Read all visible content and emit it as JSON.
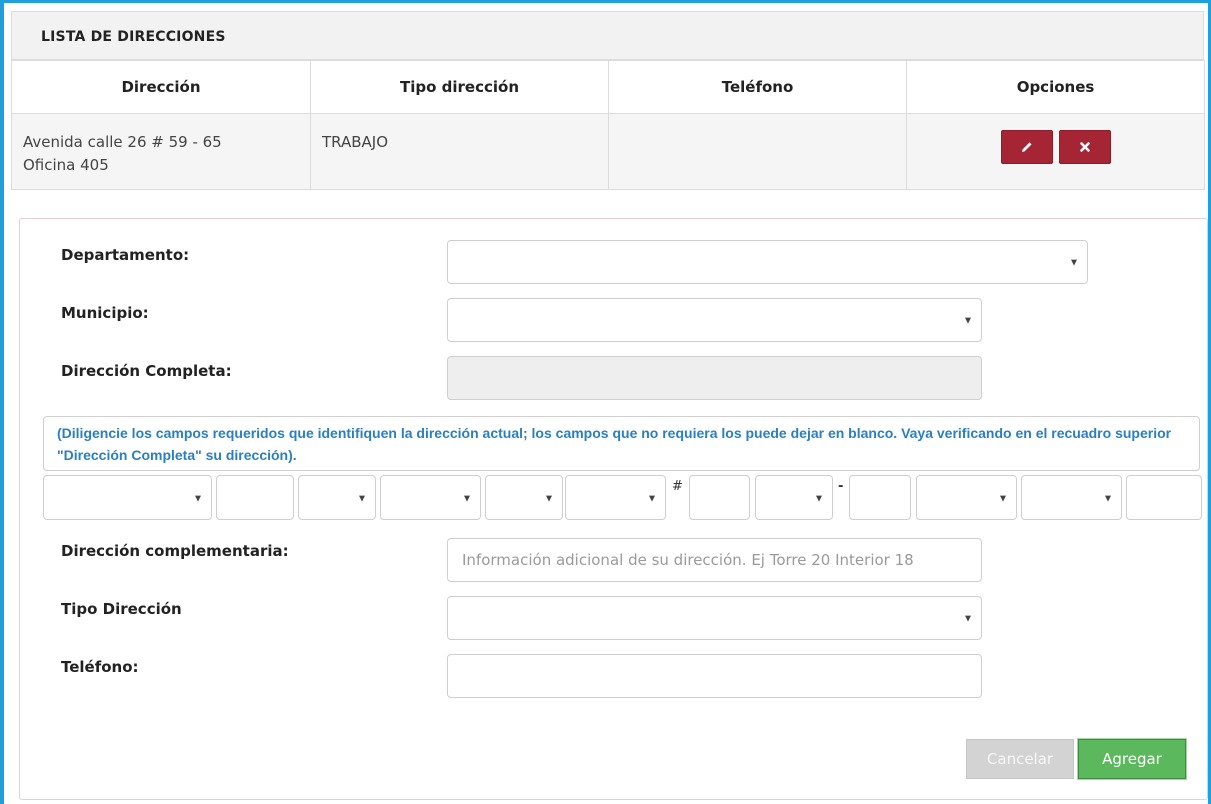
{
  "panel": {
    "title": "LISTA DE DIRECCIONES"
  },
  "table": {
    "columns": [
      "Dirección",
      "Tipo dirección",
      "Teléfono",
      "Opciones"
    ],
    "rows": [
      {
        "address_line1": "Avenida calle 26 # 59 - 65",
        "address_line2": "Oficina 405",
        "type": "TRABAJO",
        "phone": ""
      }
    ]
  },
  "form": {
    "departamento_label": "Departamento:",
    "municipio_label": "Municipio:",
    "direccion_completa_label": "Dirección Completa:",
    "hint": "(Diligencie los campos requeridos que identifiquen la dirección actual; los campos que no requiera los puede dejar en blanco. Vaya verificando en el recuadro superior \"Dirección Completa\" su dirección).",
    "hash_symbol": "#",
    "dash_symbol": "-",
    "complementaria_label": "Dirección complementaria:",
    "complementaria_placeholder": "Información adicional de su dirección. Ej Torre 20 Interior 18",
    "tipo_label": "Tipo Dirección",
    "telefono_label": "Teléfono:",
    "cancel_label": "Cancelar",
    "add_label": "Agregar"
  },
  "icons": {
    "edit": "pencil-icon",
    "delete": "times-icon"
  },
  "colors": {
    "frame": "#1ea0df",
    "danger": "#a62535",
    "success": "#5cb85c",
    "hint": "#2a7fc4"
  }
}
